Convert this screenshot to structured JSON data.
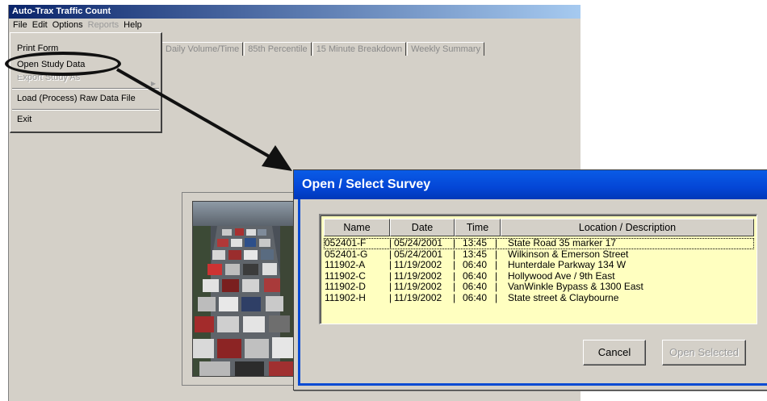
{
  "main": {
    "title": "Auto-Trax Traffic Count",
    "menu": [
      "File",
      "Edit",
      "Options",
      "Reports",
      "Help"
    ],
    "tabs": [
      "Daily Volume/Time",
      "85th Percentile",
      "15 Minute Breakdown",
      "Weekly Summary"
    ]
  },
  "file_menu": {
    "items": [
      "Print Form",
      "Open Study Data",
      "Export Study As",
      "Load (Process) Raw Data File",
      "Exit"
    ]
  },
  "dialog": {
    "title": "Open / Select Survey",
    "columns": [
      "Name",
      "Date",
      "Time",
      "Location / Description"
    ],
    "rows": [
      {
        "name": "052401-F",
        "date": "05/24/2001",
        "time": "13:45",
        "loc": "State Road 35 marker 17"
      },
      {
        "name": "052401-G",
        "date": "05/24/2001",
        "time": "13:45",
        "loc": "Wilkinson & Emerson Street"
      },
      {
        "name": "111902-A",
        "date": "11/19/2002",
        "time": "06:40",
        "loc": "Hunterdale Parkway 134 W"
      },
      {
        "name": "111902-C",
        "date": "11/19/2002",
        "time": "06:40",
        "loc": "Hollywood Ave / 9th East"
      },
      {
        "name": "111902-D",
        "date": "11/19/2002",
        "time": "06:40",
        "loc": "VanWinkle Bypass & 1300 East"
      },
      {
        "name": "111902-H",
        "date": "11/19/2002",
        "time": "06:40",
        "loc": "State street & Claybourne"
      }
    ],
    "cancel_label": "Cancel",
    "open_label": "Open Selected"
  },
  "colors": {
    "list_bg": "#ffffc0",
    "dialog_title_blue": "#0446d6"
  }
}
